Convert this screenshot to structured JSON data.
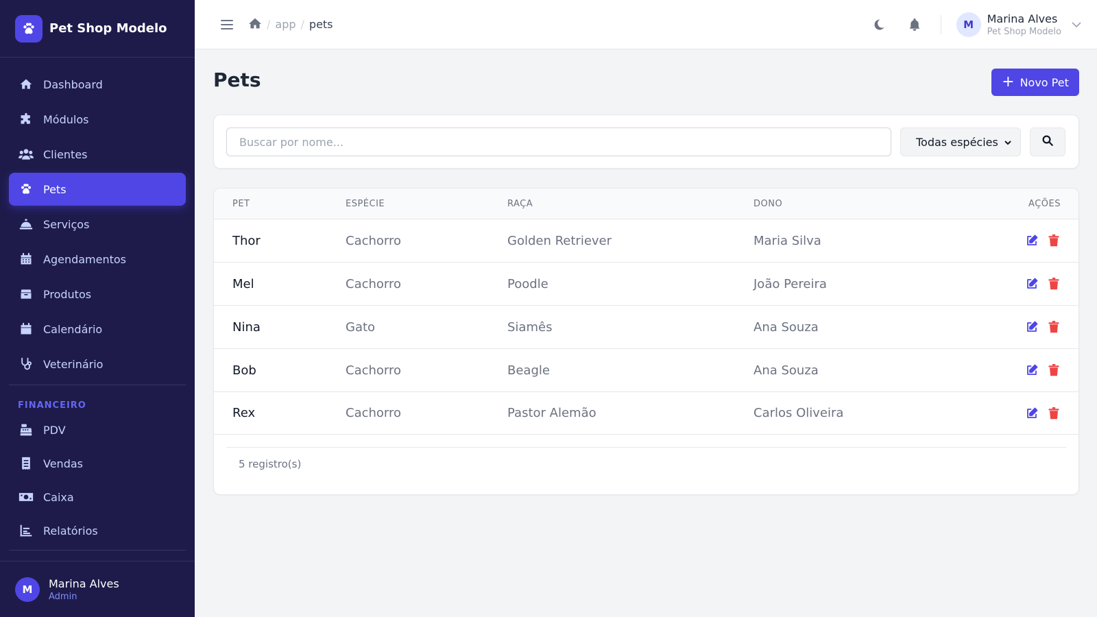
{
  "brand": {
    "name": "Pet Shop Modelo"
  },
  "sidebar": {
    "items": [
      {
        "label": "Dashboard",
        "icon": "home-icon"
      },
      {
        "label": "Módulos",
        "icon": "puzzle-icon"
      },
      {
        "label": "Clientes",
        "icon": "users-icon"
      },
      {
        "label": "Pets",
        "icon": "paw-icon",
        "active": true
      },
      {
        "label": "Serviços",
        "icon": "bell-concierge-icon"
      },
      {
        "label": "Agendamentos",
        "icon": "calendar-grid-icon"
      },
      {
        "label": "Produtos",
        "icon": "box-icon"
      },
      {
        "label": "Calendário",
        "icon": "calendar-icon"
      },
      {
        "label": "Veterinário",
        "icon": "stethoscope-icon"
      }
    ],
    "section_financeiro": "FINANCEIRO",
    "financeiro_items": [
      {
        "label": "PDV",
        "icon": "cash-register-icon"
      },
      {
        "label": "Vendas",
        "icon": "receipt-icon"
      },
      {
        "label": "Caixa",
        "icon": "money-bill-icon"
      },
      {
        "label": "Relatórios",
        "icon": "chart-icon"
      }
    ],
    "footer": {
      "avatar": "M",
      "name": "Marina Alves",
      "role": "Admin"
    }
  },
  "topbar": {
    "breadcrumb": [
      "app",
      "pets"
    ],
    "separator": "/",
    "user": {
      "avatar": "M",
      "name": "Marina Alves",
      "subtitle": "Pet Shop Modelo"
    }
  },
  "page": {
    "title": "Pets",
    "new_button": "Novo Pet",
    "new_button_plus": "+"
  },
  "filters": {
    "search_placeholder": "Buscar por nome...",
    "species_selected": "Todas espécies"
  },
  "table": {
    "headers": [
      "PET",
      "ESPÉCIE",
      "RAÇA",
      "DONO",
      "AÇÕES"
    ],
    "rows": [
      {
        "pet": "Thor",
        "species": "Cachorro",
        "breed": "Golden Retriever",
        "owner": "Maria Silva"
      },
      {
        "pet": "Mel",
        "species": "Cachorro",
        "breed": "Poodle",
        "owner": "João Pereira"
      },
      {
        "pet": "Nina",
        "species": "Gato",
        "breed": "Siamês",
        "owner": "Ana Souza"
      },
      {
        "pet": "Bob",
        "species": "Cachorro",
        "breed": "Beagle",
        "owner": "Ana Souza"
      },
      {
        "pet": "Rex",
        "species": "Cachorro",
        "breed": "Pastor Alemão",
        "owner": "Carlos Oliveira"
      }
    ],
    "footer": "5 registro(s)"
  },
  "colors": {
    "sidebar_bg": "#1e1b4b",
    "accent": "#4f46e5",
    "edit_icon": "#4f46e5",
    "delete_icon": "#ef4444"
  }
}
